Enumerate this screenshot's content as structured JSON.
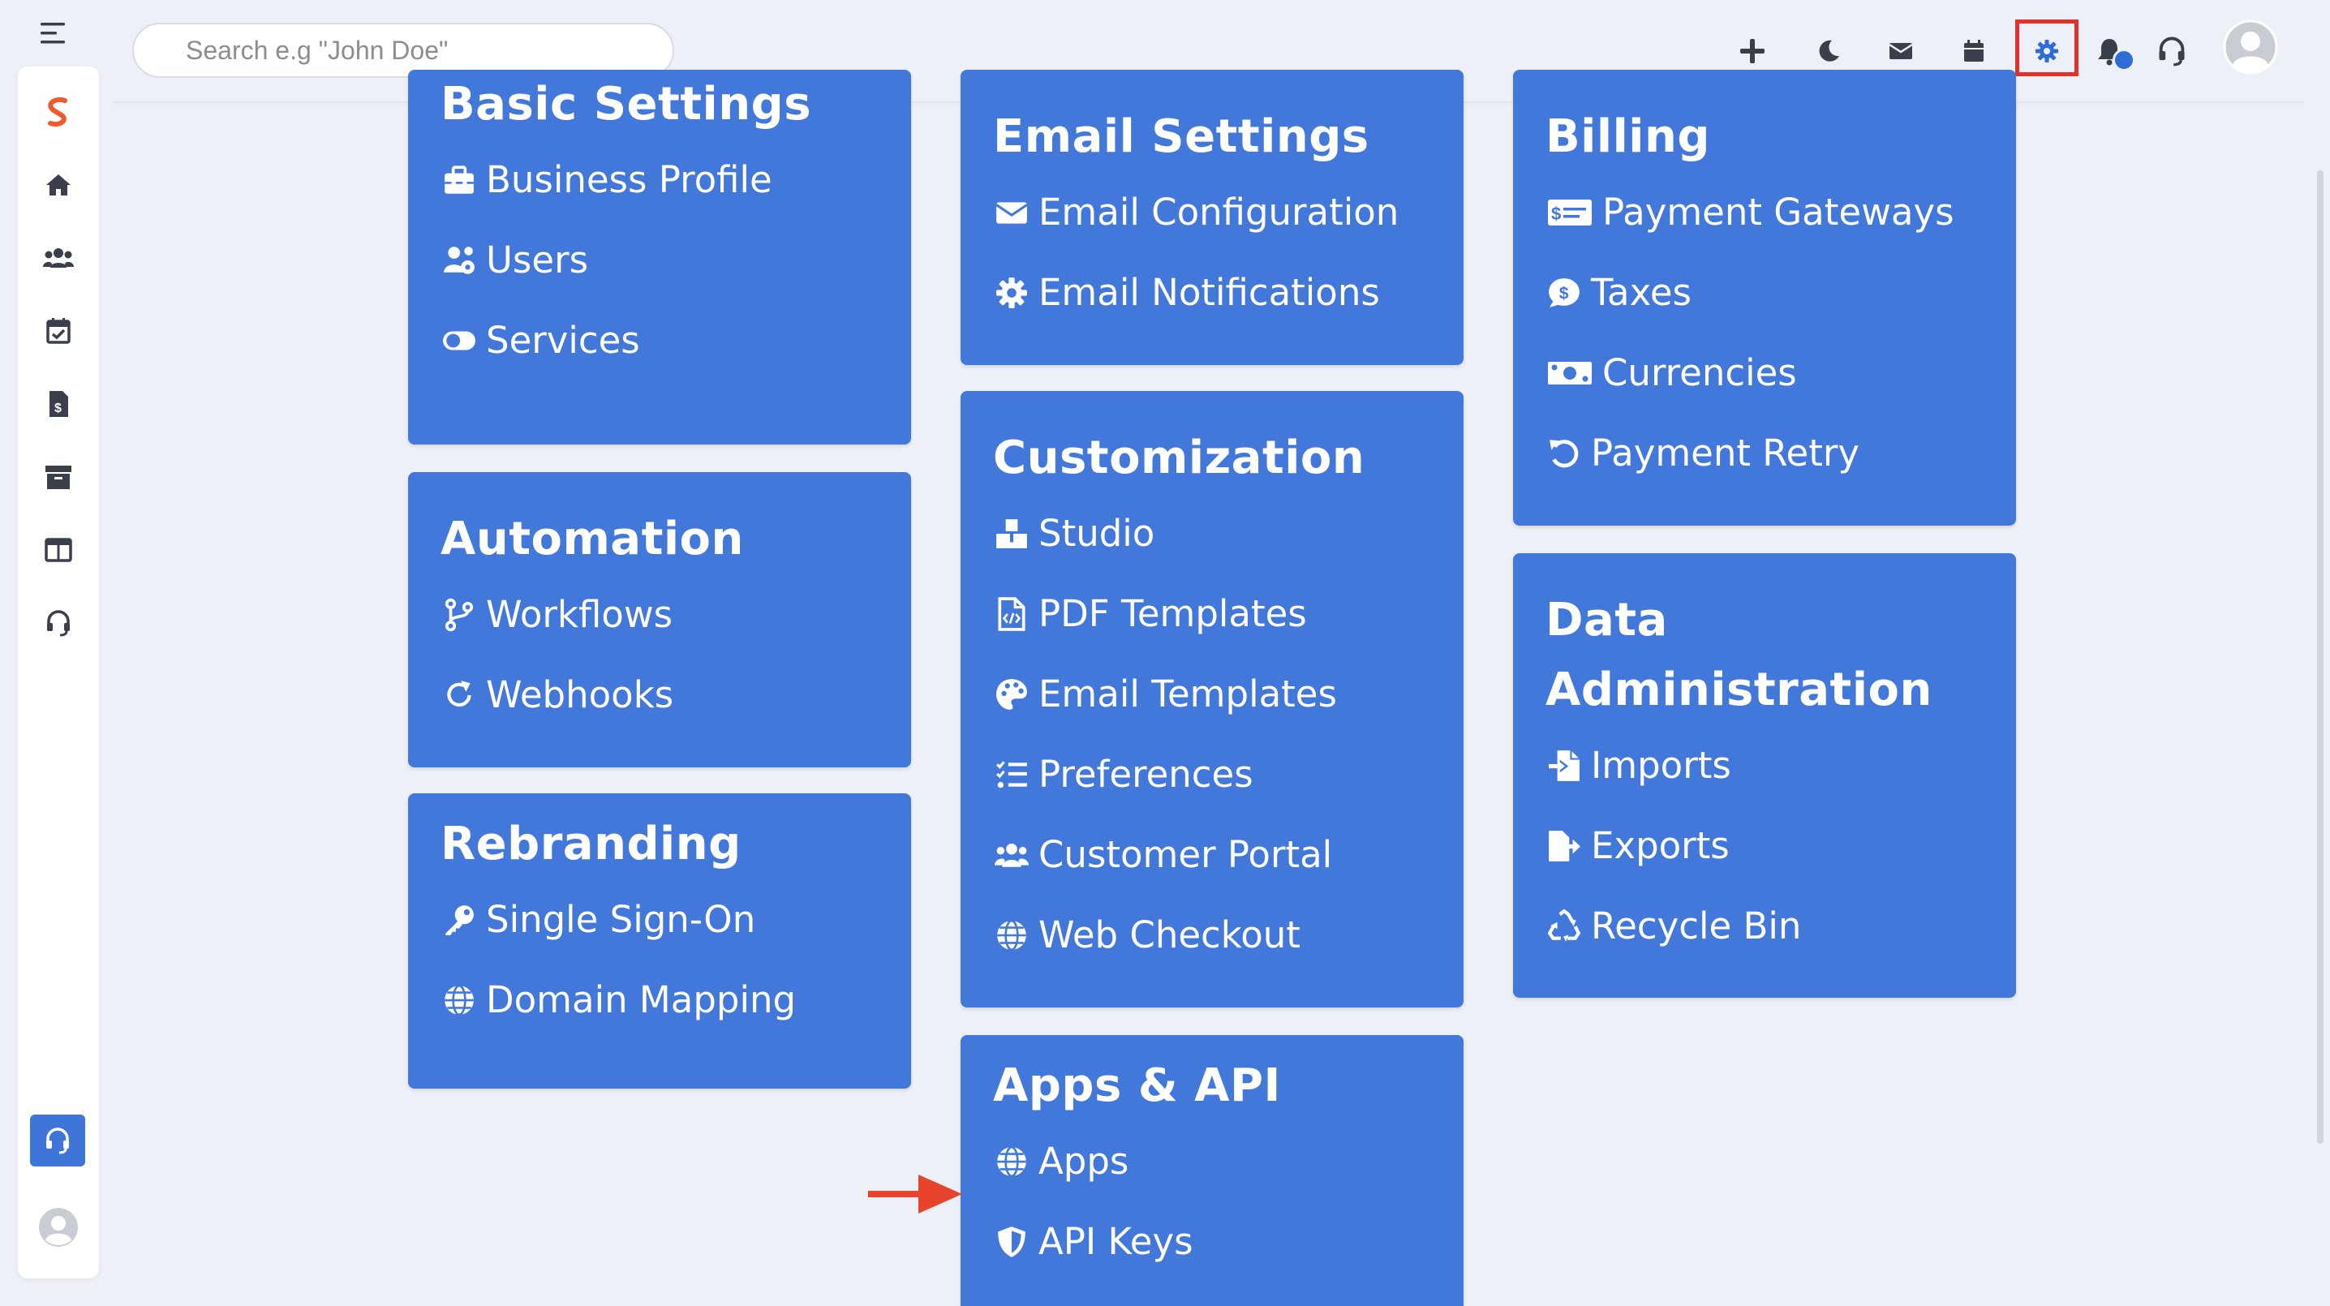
{
  "search": {
    "placeholder": "Search e.g \"John Doe\""
  },
  "topbar": {
    "icons": [
      "plus-icon",
      "moon-icon",
      "envelope-icon",
      "calendar-icon",
      "gear-icon",
      "bell-icon",
      "headset-icon",
      "avatar"
    ],
    "highlighted": "gear-icon"
  },
  "sidebar": {
    "icons": [
      "logo",
      "home-icon",
      "users-icon",
      "calendar-check-icon",
      "invoice-icon",
      "archive-icon",
      "layout-icon",
      "headset-icon"
    ]
  },
  "colors": {
    "card": "#4378db",
    "highlight": "#e4302a",
    "arrow": "#e8432b",
    "background": "#eef0f7"
  },
  "cards": {
    "basic": {
      "title": "Basic Settings",
      "items": [
        "Business Profile",
        "Users",
        "Services"
      ]
    },
    "automation": {
      "title": "Automation",
      "items": [
        "Workflows",
        "Webhooks"
      ]
    },
    "rebranding": {
      "title": "Rebranding",
      "items": [
        "Single Sign-On",
        "Domain Mapping"
      ]
    },
    "email": {
      "title": "Email Settings",
      "items": [
        "Email Configuration",
        "Email Notifications"
      ]
    },
    "customization": {
      "title": "Customization",
      "items": [
        "Studio",
        "PDF Templates",
        "Email Templates",
        "Preferences",
        "Customer Portal",
        "Web Checkout"
      ]
    },
    "apps": {
      "title": "Apps & API",
      "items": [
        "Apps",
        "API Keys"
      ]
    },
    "billing": {
      "title": "Billing",
      "items": [
        "Payment Gateways",
        "Taxes",
        "Currencies",
        "Payment Retry"
      ]
    },
    "data": {
      "title_line1": "Data",
      "title_line2": "Administration",
      "items": [
        "Imports",
        "Exports",
        "Recycle Bin"
      ]
    }
  }
}
